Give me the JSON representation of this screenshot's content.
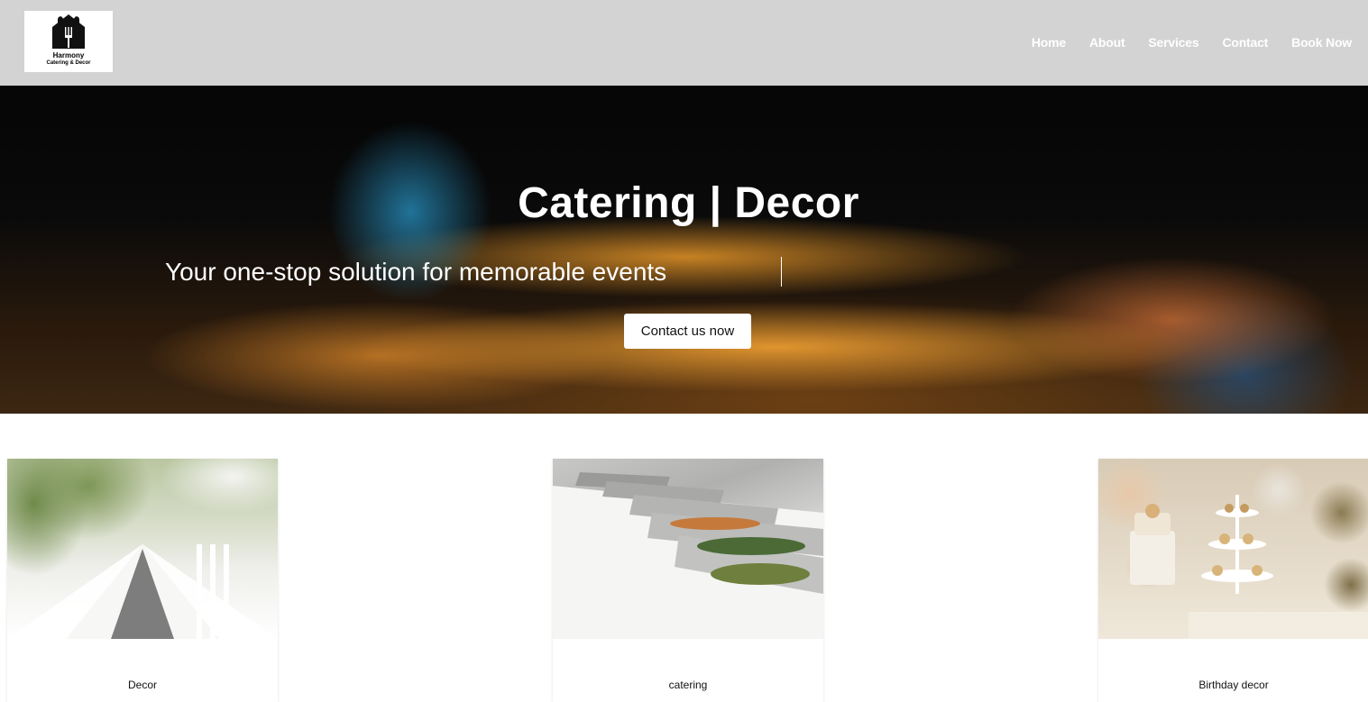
{
  "brand": {
    "name": "Harmony",
    "tagline": "Catering & Decor"
  },
  "nav": {
    "items": [
      "Home",
      "About",
      "Services",
      "Contact",
      "Book Now"
    ]
  },
  "hero": {
    "title": "Catering | Decor",
    "subtitle": "Your one-stop solution for memorable events",
    "cta_label": "Contact us now"
  },
  "cards": [
    {
      "label": "Decor",
      "image": "decor-table-photo"
    },
    {
      "label": "catering",
      "image": "catering-buffet-photo"
    },
    {
      "label": "Birthday decor",
      "image": "birthday-decor-photo"
    }
  ],
  "colors": {
    "header_bg": "#d3d3d3",
    "nav_text": "#ffffff",
    "hero_text": "#ffffff",
    "button_bg": "#ffffff"
  }
}
